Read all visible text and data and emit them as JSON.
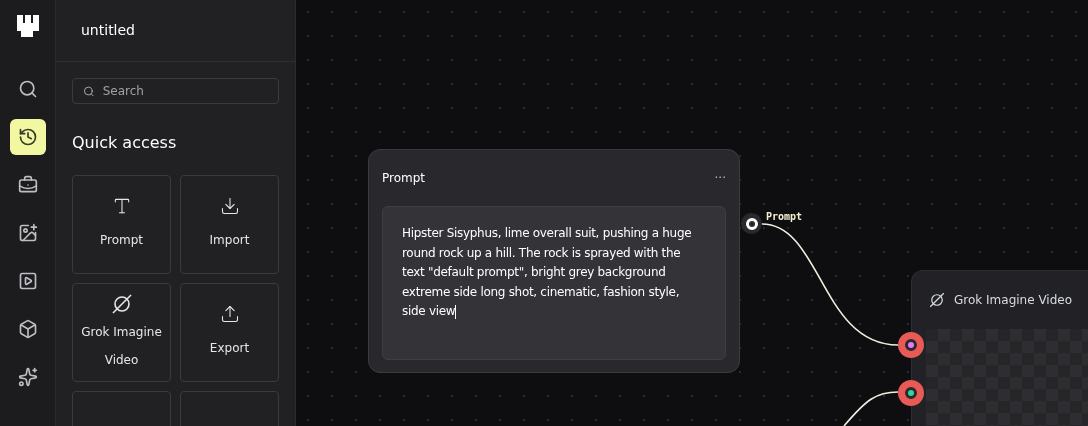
{
  "project": {
    "title": "untitled"
  },
  "rail": [
    {
      "kind": "search",
      "selected": false
    },
    {
      "kind": "history",
      "selected": true
    },
    {
      "kind": "toolbox",
      "selected": false
    },
    {
      "kind": "image",
      "selected": false
    },
    {
      "kind": "video",
      "selected": false
    },
    {
      "kind": "model",
      "selected": false
    },
    {
      "kind": "sparkles",
      "selected": false
    }
  ],
  "search": {
    "placeholder": "Search"
  },
  "quick_access": {
    "title": "Quick access",
    "tiles": [
      {
        "kind": "text",
        "label": "Prompt"
      },
      {
        "kind": "import",
        "label": "Import"
      },
      {
        "kind": "grok",
        "label": "Grok Imagine Video"
      },
      {
        "kind": "export",
        "label": "Export"
      },
      {
        "kind": "blank"
      },
      {
        "kind": "blank"
      }
    ]
  },
  "prompt_node": {
    "title": "Prompt",
    "menu": "···",
    "text": "Hipster Sisyphus, lime overall suit, pushing a huge round rock up a hill. The rock is sprayed with the text \"default prompt\", bright grey background extreme side long shot, cinematic, fashion style, side view",
    "output_label": "Prompt"
  },
  "video_node": {
    "title": "Grok Imagine Video",
    "inputs": [
      {
        "color": "#e879f9"
      },
      {
        "color": "#34d399"
      }
    ]
  }
}
